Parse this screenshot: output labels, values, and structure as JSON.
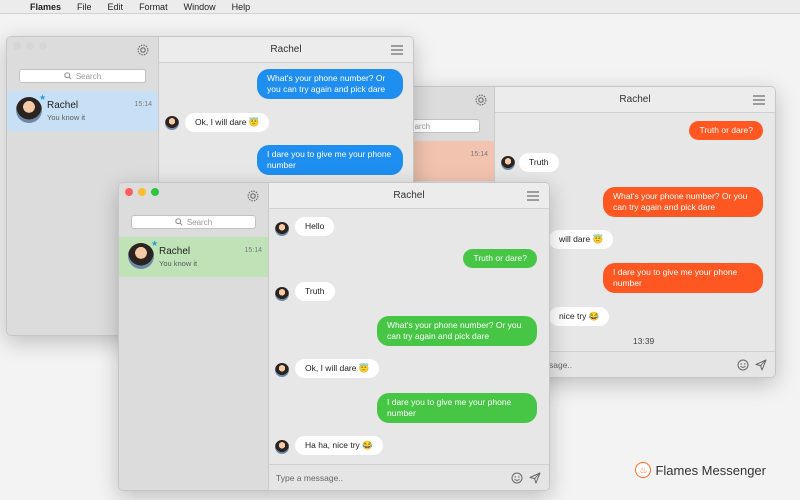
{
  "menubar": {
    "app_name": "Flames",
    "items": [
      "File",
      "Edit",
      "Format",
      "Window",
      "Help"
    ]
  },
  "search_placeholder": "Search",
  "contact": {
    "name": "Rachel",
    "snippet": "You know it",
    "time": "15:14"
  },
  "chat_title": "Rachel",
  "input_placeholder": "Type a message..",
  "back_window": {
    "search_partial": "earch",
    "input_partial": "sage..",
    "messages": [
      {
        "text": "Truth or dare?"
      },
      {
        "text": "Truth"
      },
      {
        "text": "What's your phone number? Or you can try again and pick dare"
      },
      {
        "text": "will dare 😇"
      },
      {
        "text": "I dare you to give me your phone number"
      },
      {
        "text": "nice try 😂"
      }
    ],
    "time_separator": "13:39"
  },
  "mid_window": {
    "messages": [
      {
        "text": "What's your phone number? Or you can try again and pick dare"
      },
      {
        "text": "Ok, I will dare 😇"
      },
      {
        "text": "I dare you to give me your phone number"
      }
    ]
  },
  "front_window": {
    "messages": [
      {
        "text": "Hello"
      },
      {
        "text": "Truth or dare?"
      },
      {
        "text": "Truth"
      },
      {
        "text": "What's your phone number? Or you can try again and pick dare"
      },
      {
        "text": "Ok, I will dare 😇"
      },
      {
        "text": "I dare you to give me your phone number"
      },
      {
        "text": "Ha ha, nice try 😂"
      }
    ]
  },
  "brand": {
    "name": "Flames Messenger"
  },
  "colors": {
    "blue_bubble": "#1e8ef0",
    "green_bubble": "#47c646",
    "orange_bubble": "#ff5722",
    "selected_blue": "#c8e0f6",
    "selected_green": "#bfe3b6",
    "selected_orange": "#f2c4b0"
  }
}
